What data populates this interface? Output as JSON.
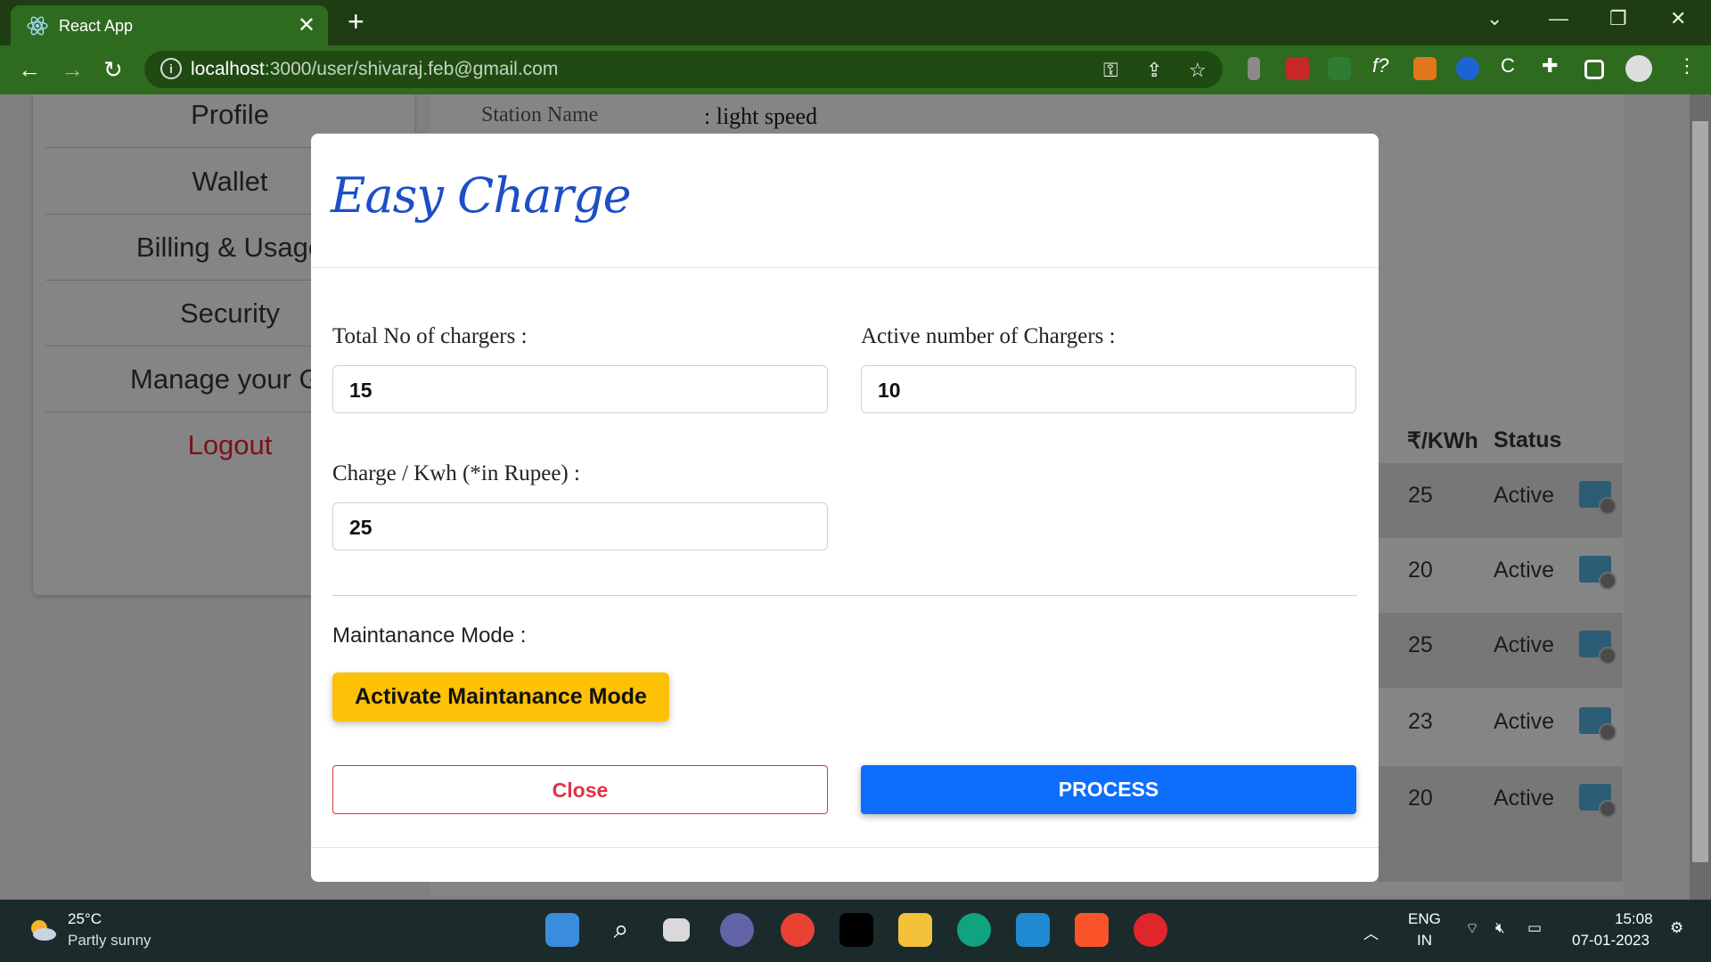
{
  "browser": {
    "tab_title": "React App",
    "url_host": "localhost",
    "url_rest": ":3000/user/shivaraj.feb@gmail.com"
  },
  "sidebar": {
    "items": [
      {
        "label": "Profile"
      },
      {
        "label": "Wallet"
      },
      {
        "label": "Billing & Usage"
      },
      {
        "label": "Security"
      },
      {
        "label": "Manage your Gr"
      },
      {
        "label": "Logout"
      }
    ]
  },
  "station": {
    "label": "Station Name",
    "value": ": light speed"
  },
  "table": {
    "headers": {
      "rate": "₹/KWh",
      "status": "Status"
    },
    "rows": [
      {
        "rate": "25",
        "status": "Active"
      },
      {
        "rate": "20",
        "status": "Active"
      },
      {
        "rate": "25",
        "status": "Active"
      },
      {
        "rate": "23",
        "status": "Active"
      },
      {
        "rate": "20",
        "status": "Active"
      }
    ]
  },
  "modal": {
    "brand": "Easy Charge",
    "total_label": "Total No of chargers :",
    "total_value": "15",
    "active_label": "Active number of Chargers :",
    "active_value": "10",
    "charge_label": "Charge / Kwh (*in Rupee) :",
    "charge_value": "25",
    "maintenance_label": "Maintanance Mode :",
    "maintenance_button": "Activate Maintanance Mode",
    "close_button": "Close",
    "process_button": "PROCESS"
  },
  "taskbar": {
    "temperature": "25°C",
    "weather": "Partly sunny",
    "lang_top": "ENG",
    "lang_bottom": "IN",
    "time": "15:08",
    "date": "07-01-2023"
  },
  "colors": {
    "brand_blue": "#1b4fc7",
    "warning": "#fdc107",
    "danger": "#dc3545",
    "primary": "#0d6efd",
    "chrome_green": "#2f6b1f"
  }
}
